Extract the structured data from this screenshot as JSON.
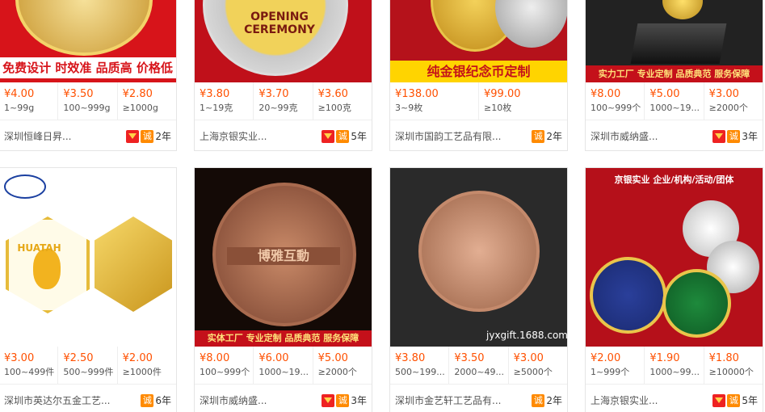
{
  "products": [
    {
      "banner": "免费设计 时效准 品质高 价格低",
      "tiers": [
        {
          "price": "¥4.00",
          "qty": "1~99g"
        },
        {
          "price": "¥3.50",
          "qty": "100~999g"
        },
        {
          "price": "¥2.80",
          "qty": "≥1000g"
        }
      ],
      "company": "深圳恒峰日昇...",
      "years": "2年",
      "has_shield": true
    },
    {
      "banner": "OPENING CEREMONY",
      "tiers": [
        {
          "price": "¥3.80",
          "qty": "1~19克"
        },
        {
          "price": "¥3.70",
          "qty": "20~99克"
        },
        {
          "price": "¥3.60",
          "qty": "≥100克"
        }
      ],
      "company": "上海京银实业...",
      "years": "5年",
      "has_shield": true
    },
    {
      "banner": "纯金银纪念币定制",
      "tiers": [
        {
          "price": "¥138.00",
          "qty": "3~9枚"
        },
        {
          "price": "¥99.00",
          "qty": "≥10枚"
        }
      ],
      "company": "深圳市国韵工艺品有限...",
      "years": "2年",
      "has_shield": false
    },
    {
      "banner": "实力工厂 专业定制 品质典范 服务保障",
      "tiers": [
        {
          "price": "¥8.00",
          "qty": "100~999个"
        },
        {
          "price": "¥5.00",
          "qty": "1000~19..."
        },
        {
          "price": "¥3.00",
          "qty": "≥2000个"
        }
      ],
      "company": "深圳市威纳盛...",
      "years": "3年",
      "has_shield": true
    },
    {
      "banner": "HUATAH",
      "tiers": [
        {
          "price": "¥3.00",
          "qty": "100~499件"
        },
        {
          "price": "¥2.50",
          "qty": "500~999件"
        },
        {
          "price": "¥2.00",
          "qty": "≥1000件"
        }
      ],
      "company": "深圳市英达尔五金工艺...",
      "years": "6年",
      "has_shield": false
    },
    {
      "banner": "实体工厂 专业定制 品质典范 服务保障",
      "coin_text": "博雅互動",
      "tiers": [
        {
          "price": "¥8.00",
          "qty": "100~999个"
        },
        {
          "price": "¥6.00",
          "qty": "1000~19..."
        },
        {
          "price": "¥5.00",
          "qty": "≥2000个"
        }
      ],
      "company": "深圳市威纳盛...",
      "years": "3年",
      "has_shield": true
    },
    {
      "banner": "jyxgift.1688.com",
      "tiers": [
        {
          "price": "¥3.80",
          "qty": "500~199..."
        },
        {
          "price": "¥3.50",
          "qty": "2000~49..."
        },
        {
          "price": "¥3.00",
          "qty": "≥5000个"
        }
      ],
      "company": "深圳市金艺轩工艺品有...",
      "years": "2年",
      "has_shield": false
    },
    {
      "banner": "京银实业 企业/机构/活动/团体",
      "tiers": [
        {
          "price": "¥2.00",
          "qty": "1~999个"
        },
        {
          "price": "¥1.90",
          "qty": "1000~99..."
        },
        {
          "price": "¥1.80",
          "qty": "≥10000个"
        }
      ],
      "company": "上海京银实业...",
      "years": "5年",
      "has_shield": true
    }
  ],
  "badge_char": "诚"
}
